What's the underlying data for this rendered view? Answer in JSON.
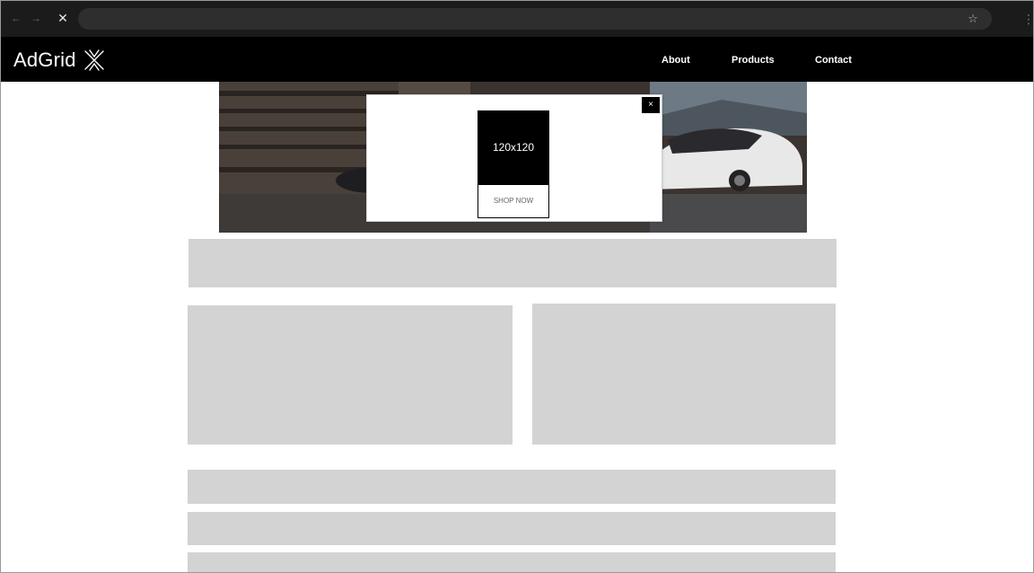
{
  "browser": {
    "back_icon": "back-arrow-icon",
    "forward_icon": "forward-arrow-icon",
    "stop_icon": "close-icon",
    "bookmark_icon": "star-icon",
    "menu_icon": "more-vert-icon"
  },
  "header": {
    "brand": "AdGrid",
    "brand_mark": "asterisk-logo-icon",
    "nav": [
      {
        "label": "About"
      },
      {
        "label": "Products"
      },
      {
        "label": "Contact"
      }
    ]
  },
  "popup": {
    "close_label": "×",
    "ad_size": "120x120",
    "cta": "SHOP NOW"
  },
  "colors": {
    "header_bg": "#000000",
    "placeholder": "#d3d3d3",
    "page_bg": "#ffffff"
  }
}
